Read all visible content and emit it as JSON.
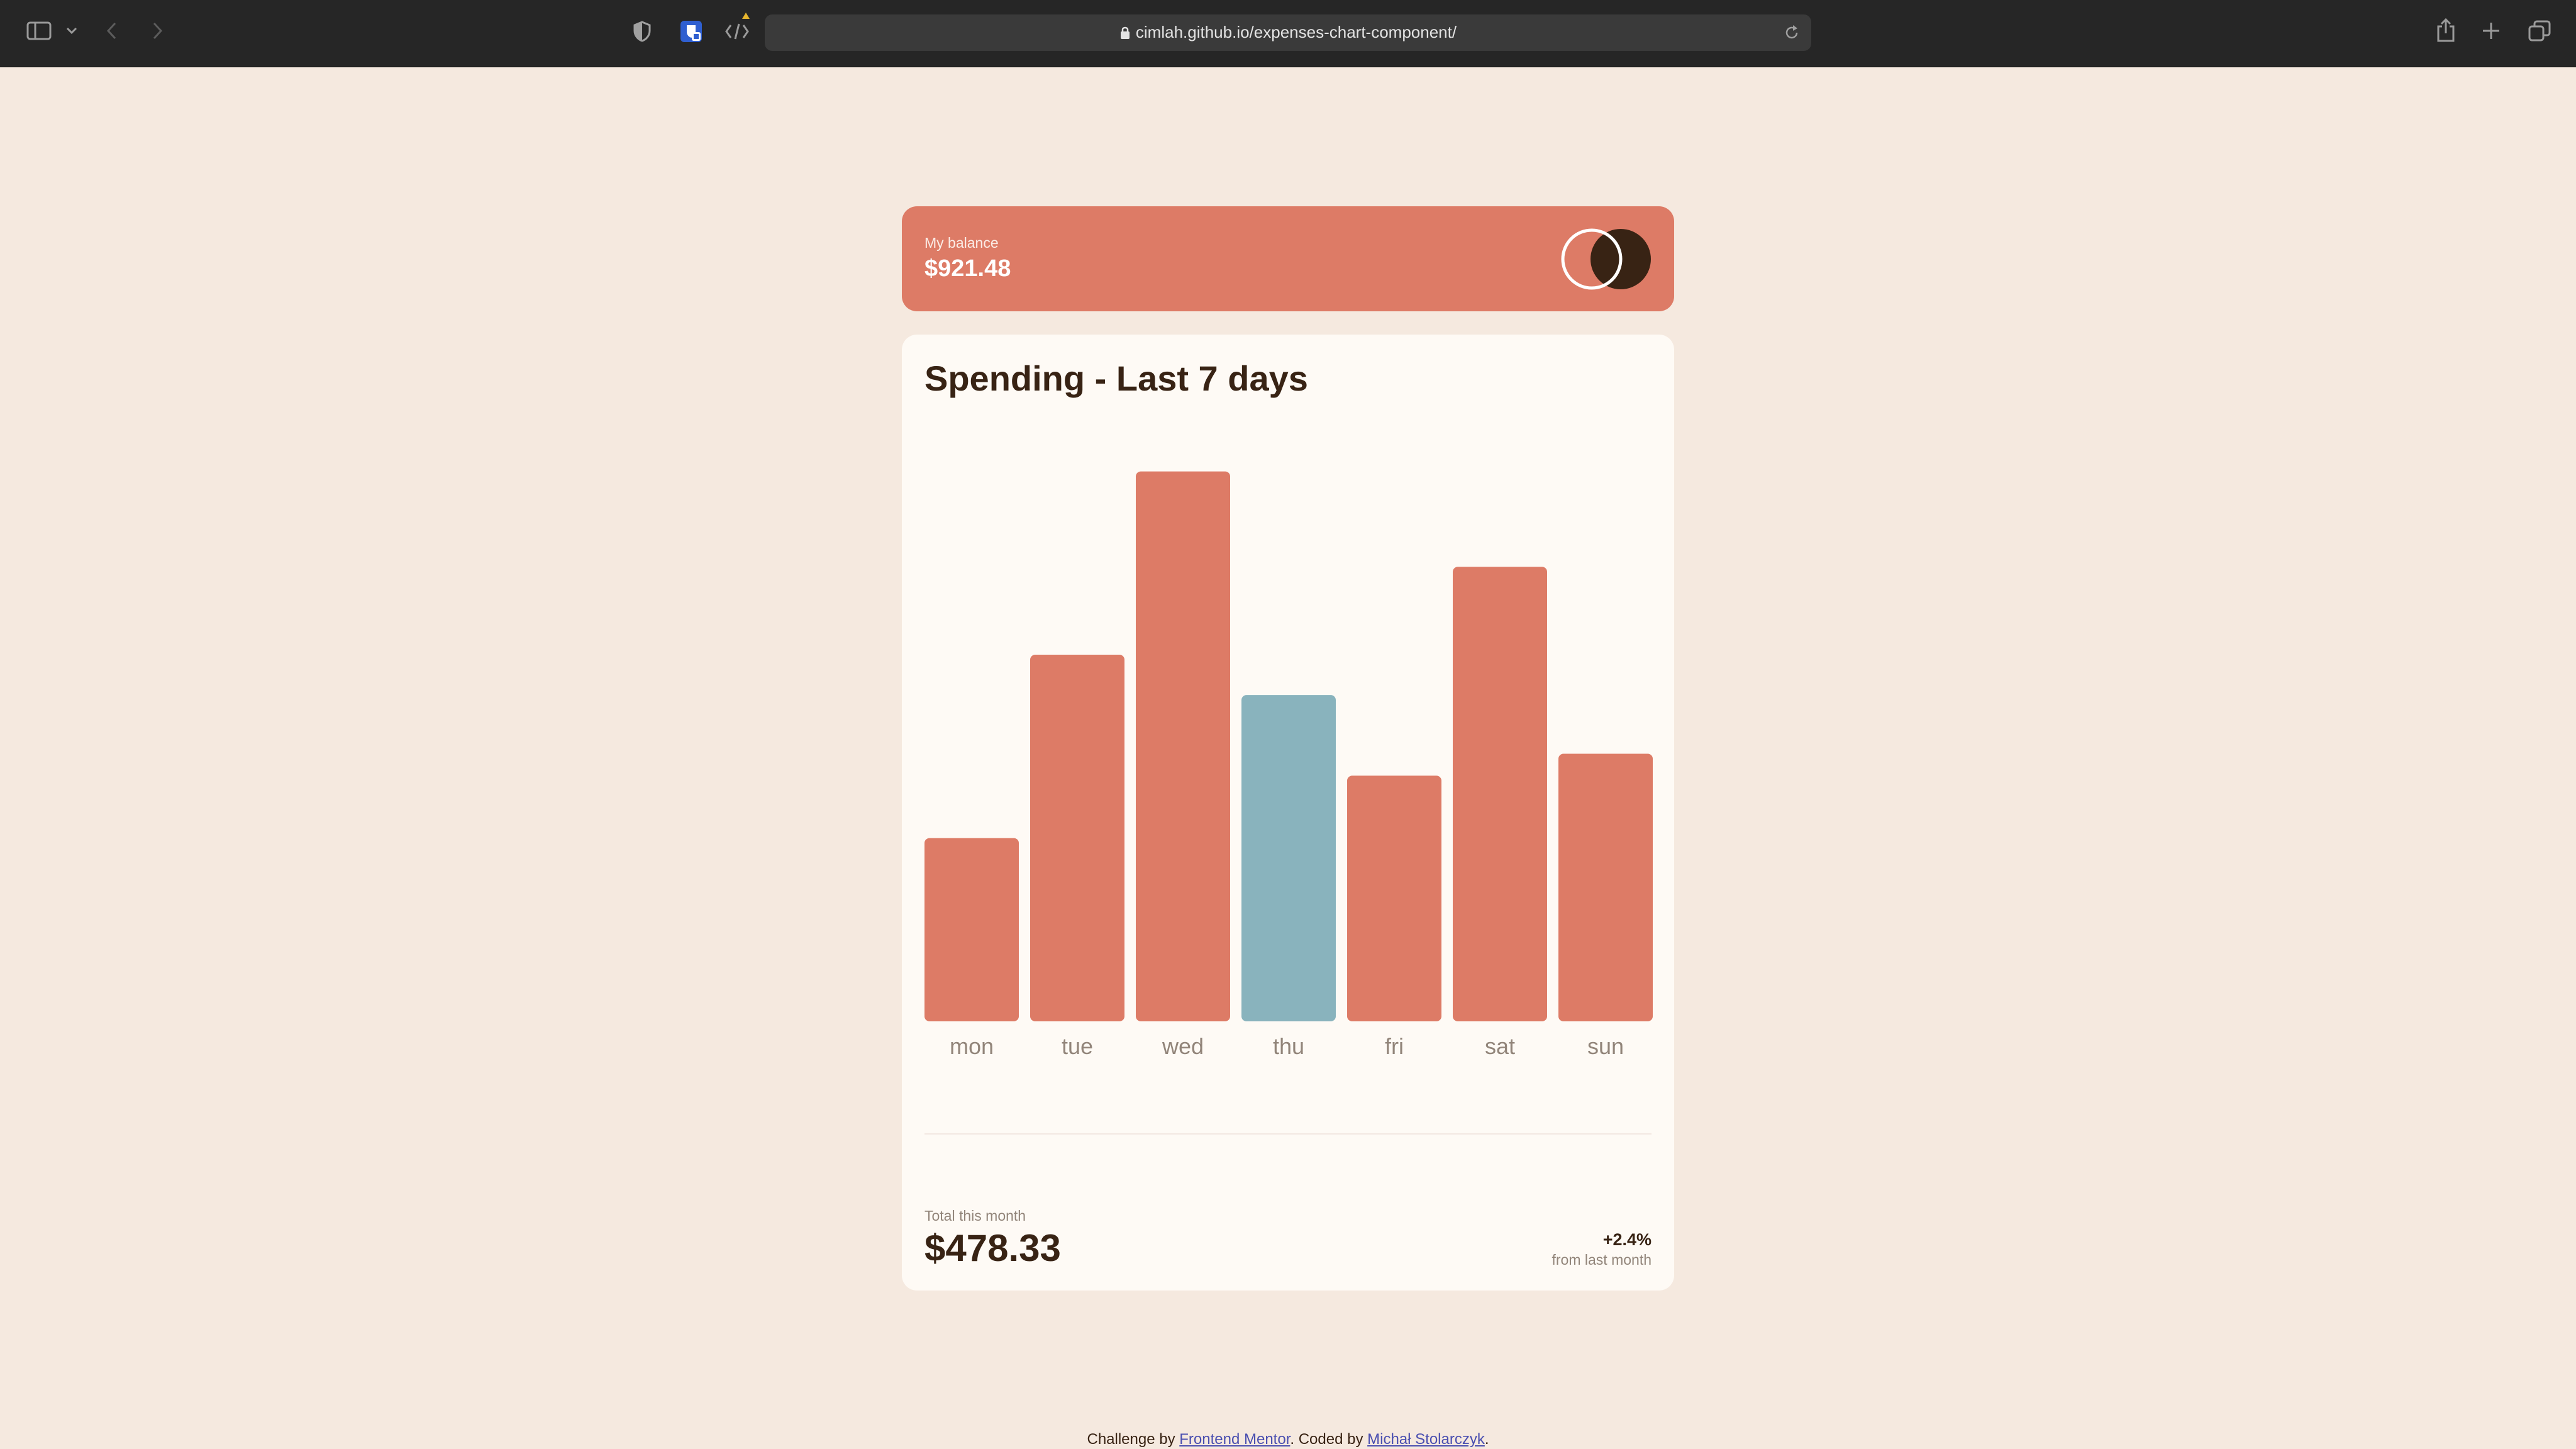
{
  "browser": {
    "url": "cimlah.github.io/expenses-chart-component/",
    "icons": [
      "sidebar-icon",
      "chevron-down-icon",
      "back-icon",
      "forward-icon",
      "shield-icon",
      "extension-icon",
      "code-icon",
      "lock-icon",
      "reload-icon",
      "share-icon",
      "plus-icon",
      "tabs-icon"
    ]
  },
  "balance": {
    "label": "My balance",
    "value": "$921.48"
  },
  "spending": {
    "title": "Spending - Last 7 days",
    "total_label": "Total this month",
    "total_value": "$478.33",
    "change_value": "+2.4%",
    "change_label": "from last month"
  },
  "chart_data": {
    "type": "bar",
    "categories": [
      "mon",
      "tue",
      "wed",
      "thu",
      "fri",
      "sat",
      "sun"
    ],
    "values": [
      17.45,
      34.91,
      52.36,
      31.07,
      23.39,
      43.28,
      25.48
    ],
    "highlight_index": 3,
    "colors": {
      "bar": "#dd7b66",
      "highlight": "#89b3bd",
      "label": "#92857a"
    }
  },
  "footer": {
    "prefix": "Challenge by",
    "link1": "Frontend Mentor",
    "middle": ". Coded by",
    "link2": "Michał Stolarczyk",
    "suffix": "."
  },
  "colors": {
    "background": "#f5e9df",
    "card": "#fefaf5",
    "accent": "#dd7b66",
    "cyan": "#89b3bd",
    "dark": "#382314"
  }
}
